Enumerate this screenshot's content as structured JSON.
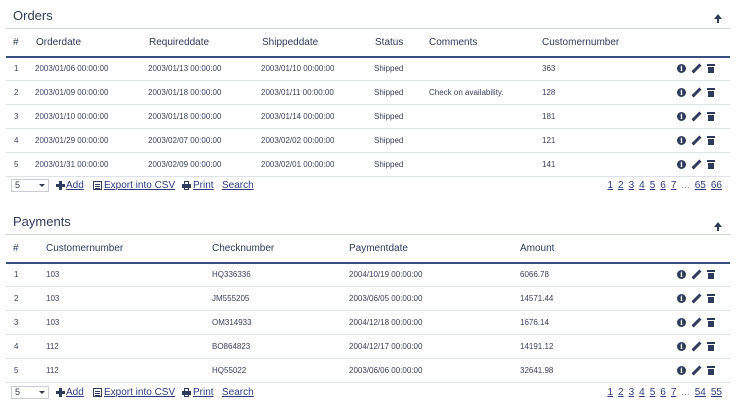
{
  "orders": {
    "title": "Orders",
    "columns": [
      "#",
      "Orderdate",
      "Requireddate",
      "Shippeddate",
      "Status",
      "Comments",
      "Customernumber"
    ],
    "rows": [
      [
        "1",
        "2003/01/06 00:00:00",
        "2003/01/13 00:00:00",
        "2003/01/10 00:00:00",
        "Shipped",
        "",
        "363"
      ],
      [
        "2",
        "2003/01/09 00:00:00",
        "2003/01/18 00:00:00",
        "2003/01/11 00:00:00",
        "Shipped",
        "Check on availability.",
        "128"
      ],
      [
        "3",
        "2003/01/10 00:00:00",
        "2003/01/18 00:00:00",
        "2003/01/14 00:00:00",
        "Shipped",
        "",
        "181"
      ],
      [
        "4",
        "2003/01/29 00:00:00",
        "2003/02/07 00:00:00",
        "2003/02/02 00:00:00",
        "Shipped",
        "",
        "121"
      ],
      [
        "5",
        "2003/01/31 00:00:00",
        "2003/02/09 00:00:00",
        "2003/02/01 00:00:00",
        "Shipped",
        "",
        "141"
      ]
    ],
    "footer": {
      "page_size": "5",
      "add_label": "Add",
      "export_label": "Export into CSV",
      "print_label": "Print",
      "search_label": "Search",
      "pages": [
        "1",
        "2",
        "3",
        "4",
        "5",
        "6",
        "7",
        "...",
        "65",
        "66"
      ]
    }
  },
  "payments": {
    "title": "Payments",
    "columns": [
      "#",
      "Customernumber",
      "Checknumber",
      "Paymentdate",
      "Amount"
    ],
    "rows": [
      [
        "1",
        "103",
        "HQ336336",
        "2004/10/19 00:00:00",
        "6066.78"
      ],
      [
        "2",
        "103",
        "JM555205",
        "2003/06/05 00:00:00",
        "14571.44"
      ],
      [
        "3",
        "103",
        "OM314933",
        "2004/12/18 00:00:00",
        "1676.14"
      ],
      [
        "4",
        "112",
        "BO864823",
        "2004/12/17 00:00:00",
        "14191.12"
      ],
      [
        "5",
        "112",
        "HQ55022",
        "2003/06/06 00:00:00",
        "32641.98"
      ]
    ],
    "footer": {
      "page_size": "5",
      "add_label": "Add",
      "export_label": "Export into CSV",
      "print_label": "Print",
      "search_label": "Search",
      "pages": [
        "1",
        "2",
        "3",
        "4",
        "5",
        "6",
        "7",
        "...",
        "54",
        "55"
      ]
    }
  },
  "icons": [
    "collapse-up-icon",
    "info-icon",
    "edit-icon",
    "trash-icon",
    "plus-icon",
    "csv-icon",
    "print-icon",
    "chevron-down-icon"
  ],
  "colors": {
    "header_text": "#2f3b5c",
    "link": "#2f3b7e",
    "header_rule": "#3b4d7e"
  }
}
